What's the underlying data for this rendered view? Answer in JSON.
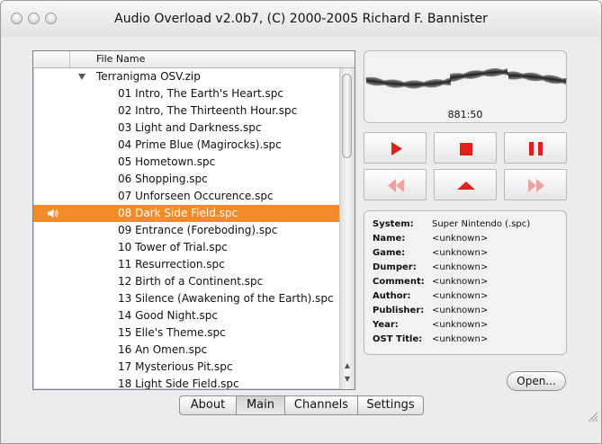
{
  "window": {
    "title": "Audio Overload v2.0b7, (C) 2000-2005 Richard F. Bannister"
  },
  "file_list": {
    "column_header": "File Name",
    "folder": "Terranigma OSV.zip",
    "items": [
      "01 Intro, The Earth's Heart.spc",
      "02 Intro, The Thirteenth Hour.spc",
      "03 Light and Darkness.spc",
      "04 Prime Blue (Magirocks).spc",
      "05 Hometown.spc",
      "06 Shopping.spc",
      "07 Unforseen Occurence.spc",
      "08 Dark Side Field.spc",
      "09 Entrance (Foreboding).spc",
      "10 Tower of Trial.spc",
      "11 Resurrection.spc",
      "12 Birth of a Continent.spc",
      "13 Silence (Awakening of the Earth).spc",
      "14 Good Night.spc",
      "15 Elle's Theme.spc",
      "16 An Omen.spc",
      "17 Mysterious Pit.spc",
      "18 Light Side Field.spc"
    ],
    "playing_item": "08 Dark Side Field.spc"
  },
  "player": {
    "time": "881:50"
  },
  "info": {
    "rows": [
      {
        "label": "System:",
        "value": "Super Nintendo (.spc)"
      },
      {
        "label": "Name:",
        "value": "<unknown>"
      },
      {
        "label": "Game:",
        "value": "<unknown>"
      },
      {
        "label": "Dumper:",
        "value": "<unknown>"
      },
      {
        "label": "Comment:",
        "value": "<unknown>"
      },
      {
        "label": "Author:",
        "value": "<unknown>"
      },
      {
        "label": "Publisher:",
        "value": "<unknown>"
      },
      {
        "label": "Year:",
        "value": "<unknown>"
      },
      {
        "label": "OST Title:",
        "value": "<unknown>"
      }
    ]
  },
  "buttons": {
    "open": "Open..."
  },
  "tabs": [
    "About",
    "Main",
    "Channels",
    "Settings"
  ],
  "active_tab": "Main",
  "colors": {
    "selection": "#f58a2a",
    "control_icon": "#e0201a"
  },
  "icons": {
    "play": "play-icon",
    "stop": "stop-icon",
    "pause": "pause-icon",
    "rewind": "rewind-icon",
    "eject": "eject-icon",
    "fast_forward": "fast-forward-icon",
    "speaker": "speaker-icon"
  }
}
